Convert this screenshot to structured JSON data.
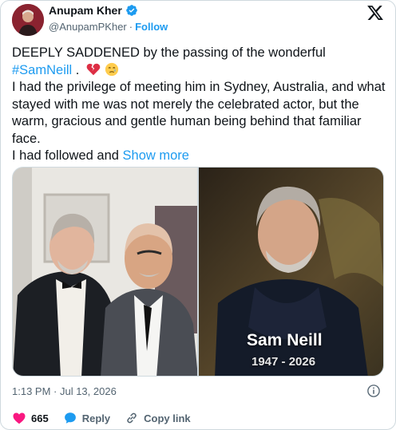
{
  "author": {
    "name": "Anupam Kher",
    "handle": "@AnupamPKher",
    "separator": "·",
    "follow_label": "Follow"
  },
  "post": {
    "line1": "DEEPLY SADDENED by the passing of the wonderful",
    "hashtag": "#SamNeill",
    "hashtag_suffix": " .",
    "line3": "I had the privilege of meeting him in Sydney, Australia, and what stayed with me was not merely the celebrated actor, but the warm, gracious and gentle human being behind that familiar face.",
    "line4": "I had followed and",
    "show_more": "Show more"
  },
  "media": {
    "caption_name": "Sam Neill",
    "caption_years": "1947 - 2026"
  },
  "meta": {
    "timestamp": "1:13 PM · Jul 13, 2026"
  },
  "actions": {
    "like_count": "665",
    "reply_label": "Reply",
    "copy_link_label": "Copy link"
  },
  "colors": {
    "accent": "#1d9bf0",
    "like": "#f91880",
    "text": "#0f1419",
    "muted": "#536471"
  }
}
